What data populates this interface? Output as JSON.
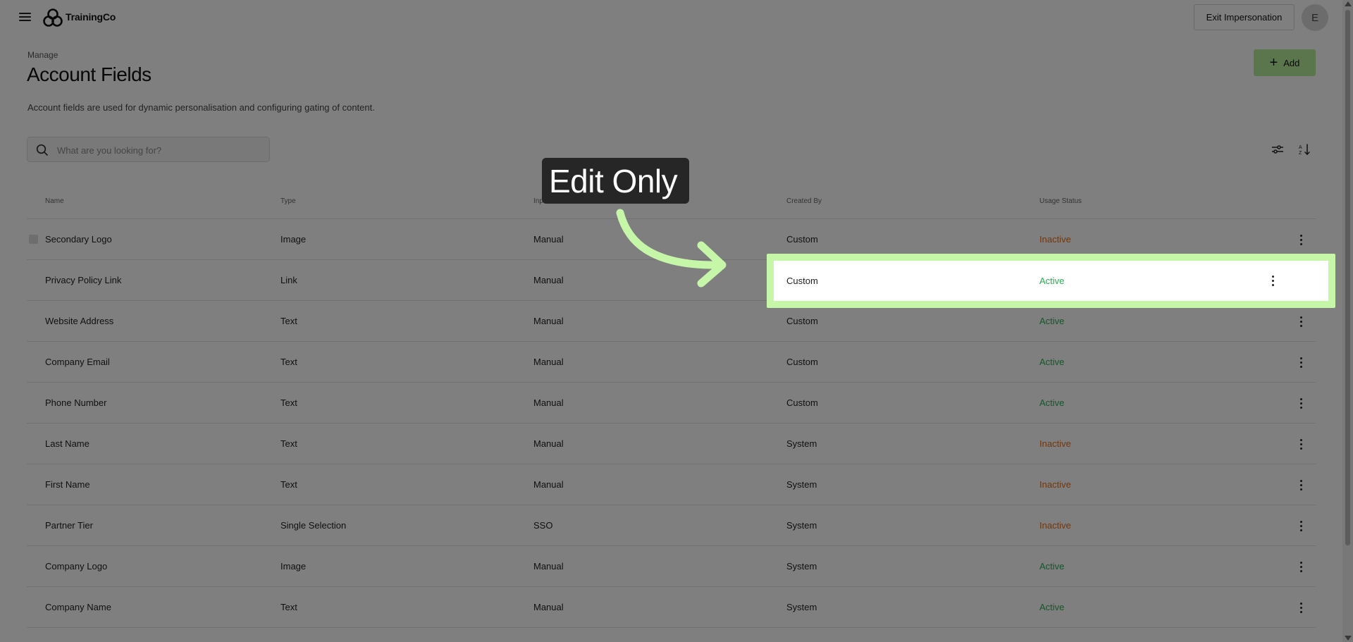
{
  "app": {
    "brand": "TrainingCo",
    "exit_label": "Exit Impersonation",
    "avatar_initial": "E"
  },
  "page": {
    "breadcrumb": "Manage",
    "title": "Account Fields",
    "description": "Account fields are used for dynamic personalisation and configuring gating of content.",
    "add_label": "Add"
  },
  "search": {
    "placeholder": "What are you looking for?"
  },
  "table": {
    "headers": {
      "name": "Name",
      "type": "Type",
      "input_method": "Input Method",
      "created_by": "Created By",
      "usage_status": "Usage Status"
    },
    "rows": [
      {
        "name": "Secondary Logo",
        "type": "Image",
        "input": "Manual",
        "created_by": "Custom",
        "status": "Inactive"
      },
      {
        "name": "Privacy Policy Link",
        "type": "Link",
        "input": "Manual",
        "created_by": "Custom",
        "status": "Active"
      },
      {
        "name": "Website Address",
        "type": "Text",
        "input": "Manual",
        "created_by": "Custom",
        "status": "Active"
      },
      {
        "name": "Company Email",
        "type": "Text",
        "input": "Manual",
        "created_by": "Custom",
        "status": "Active"
      },
      {
        "name": "Phone Number",
        "type": "Text",
        "input": "Manual",
        "created_by": "Custom",
        "status": "Active"
      },
      {
        "name": "Last Name",
        "type": "Text",
        "input": "Manual",
        "created_by": "System",
        "status": "Inactive"
      },
      {
        "name": "First Name",
        "type": "Text",
        "input": "Manual",
        "created_by": "System",
        "status": "Inactive"
      },
      {
        "name": "Partner Tier",
        "type": "Single Selection",
        "input": "SSO",
        "created_by": "System",
        "status": "Inactive"
      },
      {
        "name": "Company Logo",
        "type": "Image",
        "input": "Manual",
        "created_by": "System",
        "status": "Active"
      },
      {
        "name": "Company Name",
        "type": "Text",
        "input": "Manual",
        "created_by": "System",
        "status": "Active"
      }
    ]
  },
  "highlight": {
    "created_by": "Custom",
    "status": "Active"
  },
  "callout": {
    "text": "Edit Only"
  },
  "colors": {
    "accent": "#b7ea9a",
    "highlight": "#c6f7a8",
    "active": "#2faa55",
    "inactive": "#e07020"
  },
  "icons": {
    "menu": "hamburger-icon",
    "logo": "trainingco-logo",
    "add": "plus-icon",
    "search": "search-icon",
    "filter": "sliders-icon",
    "sort": "sort-icon",
    "row_menu": "kebab-icon",
    "annotation": "curved-arrow-icon"
  }
}
